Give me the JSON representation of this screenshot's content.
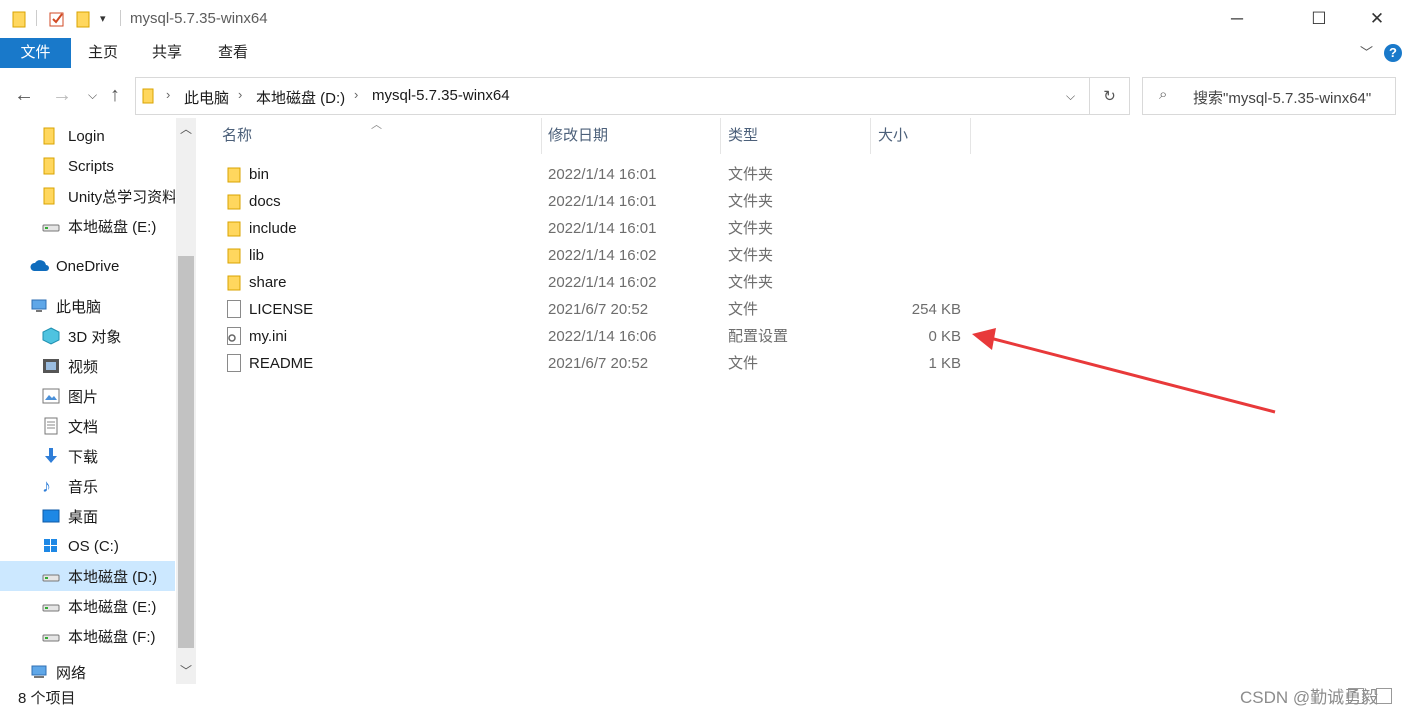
{
  "window": {
    "title": "mysql-5.7.35-winx64",
    "controls": [
      "minimize-icon",
      "maximize-icon",
      "close-icon"
    ]
  },
  "ribbon": {
    "tabs": [
      "文件",
      "主页",
      "共享",
      "查看"
    ]
  },
  "address": {
    "crumbs": [
      "此电脑",
      "本地磁盘 (D:)",
      "mysql-5.7.35-winx64"
    ],
    "search_placeholder": "搜索\"mysql-5.7.35-winx64\""
  },
  "nav": {
    "items": [
      {
        "label": "Login",
        "icon": "folder-icon"
      },
      {
        "label": "Scripts",
        "icon": "folder-icon"
      },
      {
        "label": "Unity总学习资料",
        "icon": "folder-icon"
      },
      {
        "label": "本地磁盘 (E:)",
        "icon": "drive-icon"
      },
      {
        "label": "OneDrive",
        "icon": "cloud-icon"
      },
      {
        "label": "此电脑",
        "icon": "computer-icon"
      },
      {
        "label": "3D 对象",
        "icon": "3d-objects-icon"
      },
      {
        "label": "视频",
        "icon": "video-icon"
      },
      {
        "label": "图片",
        "icon": "pictures-icon"
      },
      {
        "label": "文档",
        "icon": "documents-icon"
      },
      {
        "label": "下载",
        "icon": "download-icon"
      },
      {
        "label": "音乐",
        "icon": "music-icon"
      },
      {
        "label": "桌面",
        "icon": "desktop-icon"
      },
      {
        "label": "OS (C:)",
        "icon": "windows-drive-icon"
      },
      {
        "label": "本地磁盘 (D:)",
        "icon": "drive-icon",
        "selected": true
      },
      {
        "label": "本地磁盘 (E:)",
        "icon": "drive-icon"
      },
      {
        "label": "本地磁盘 (F:)",
        "icon": "drive-icon"
      },
      {
        "label": "网络",
        "icon": "network-icon"
      }
    ]
  },
  "columns": [
    "名称",
    "修改日期",
    "类型",
    "大小"
  ],
  "files": [
    {
      "name": "bin",
      "date": "2022/1/14 16:01",
      "type": "文件夹",
      "size": "",
      "icon": "folder-icon"
    },
    {
      "name": "docs",
      "date": "2022/1/14 16:01",
      "type": "文件夹",
      "size": "",
      "icon": "folder-icon"
    },
    {
      "name": "include",
      "date": "2022/1/14 16:01",
      "type": "文件夹",
      "size": "",
      "icon": "folder-icon"
    },
    {
      "name": "lib",
      "date": "2022/1/14 16:02",
      "type": "文件夹",
      "size": "",
      "icon": "folder-icon"
    },
    {
      "name": "share",
      "date": "2022/1/14 16:02",
      "type": "文件夹",
      "size": "",
      "icon": "folder-icon"
    },
    {
      "name": "LICENSE",
      "date": "2021/6/7 20:52",
      "type": "文件",
      "size": "254 KB",
      "icon": "file-icon"
    },
    {
      "name": "my.ini",
      "date": "2022/1/14 16:06",
      "type": "配置设置",
      "size": "0 KB",
      "icon": "config-file-icon"
    },
    {
      "name": "README",
      "date": "2021/6/7 20:52",
      "type": "文件",
      "size": "1 KB",
      "icon": "file-icon"
    }
  ],
  "status": {
    "count": "8 个项目"
  },
  "watermark": "CSDN @勤诚勇毅",
  "colors": {
    "accent": "#1979ca",
    "selection": "#cce8ff",
    "folder": "#ffd75e",
    "arrow": "#e8393a"
  }
}
